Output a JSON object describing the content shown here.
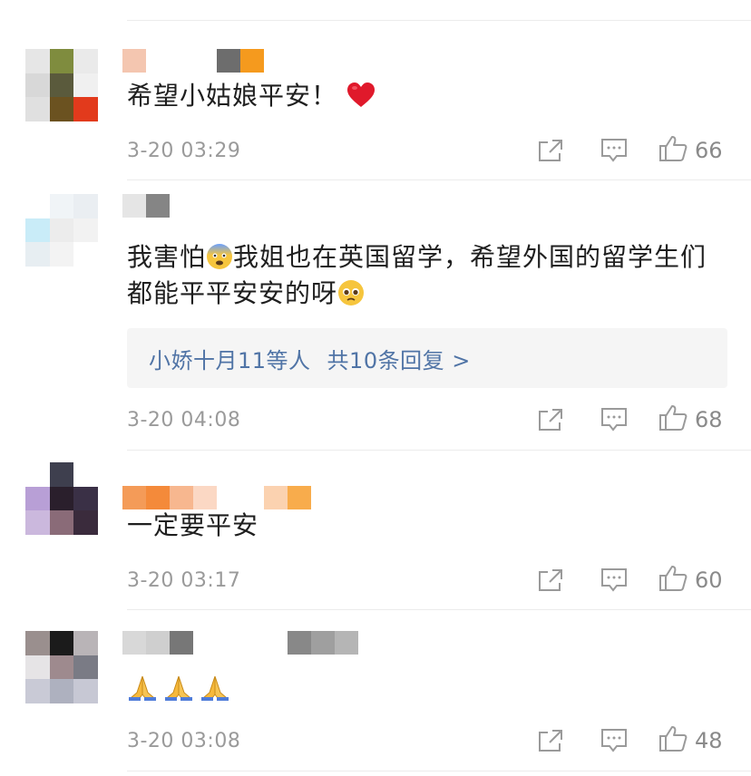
{
  "comments": [
    {
      "text": "希望小姑娘平安！",
      "reactions": [
        "red-heart"
      ],
      "time": "3-20 03:29",
      "likes": "66",
      "avatar_colors": [
        "#e6e6e6",
        "#7f8c3e",
        "#eaeaea",
        "#d8d8d8",
        "#5a5a3c",
        "#f0f0f0",
        "#e0e0e0",
        "#6b5220",
        "#e23a1c"
      ],
      "name_colors": [
        "#f4c6b0",
        "#ffffff",
        "#ffffff",
        "#ffffff",
        "#6d6d6d",
        "#f59a1e"
      ]
    },
    {
      "text_before_emoji": "我害怕",
      "text_after_emoji": "我姐也在英国留学，希望外国的留学生们都能平平安安的呀",
      "emojis": [
        "anxious-face",
        "pleading-face"
      ],
      "replies_names": "小娇十月11等人",
      "replies_count": "共10条回复 >",
      "time": "3-20 04:08",
      "likes": "68",
      "avatar_colors": [
        "#ffffff",
        "#f0f4f7",
        "#eaeef2",
        "#c9ecf8",
        "#ececec",
        "#f2f2f2",
        "#e7eef2",
        "#f3f3f3",
        "#ffffff"
      ],
      "name_colors": [
        "#e5e5e5",
        "#858585"
      ]
    },
    {
      "text": "一定要平安",
      "time": "3-20 03:17",
      "likes": "60",
      "avatar_colors": [
        "#ffffff",
        "#3e3f4e",
        "#ffffff",
        "#b89fd6",
        "#2a1f2c",
        "#3a3046",
        "#cbb8dd",
        "#8a6b78",
        "#3a2b3c"
      ],
      "name_colors": [
        "#f49b58",
        "#f48a3a",
        "#f7b78f",
        "#fbd8c4",
        "#ffffff",
        "#ffffff",
        "#fbd2b0",
        "#f8ac4c"
      ]
    },
    {
      "text": "",
      "emojis": [
        "folded-hands",
        "folded-hands",
        "folded-hands"
      ],
      "time": "3-20 03:08",
      "likes": "48",
      "avatar_colors": [
        "#9a8f8e",
        "#1b1b1b",
        "#b9b4b7",
        "#e6e4e6",
        "#9e8a8e",
        "#7a7b85",
        "#c9cad6",
        "#aeb1bf",
        "#c7c8d4"
      ],
      "name_colors": [
        "#d8d8d8",
        "#cfcfcf",
        "#777777",
        "#ffffff",
        "#ffffff",
        "#ffffff",
        "#ffffff",
        "#888888",
        "#9f9f9f",
        "#b5b5b5"
      ]
    }
  ],
  "colors": {
    "reply_link": "#5074a6",
    "meta_text": "#9a9a9a",
    "divider": "#ececec"
  }
}
